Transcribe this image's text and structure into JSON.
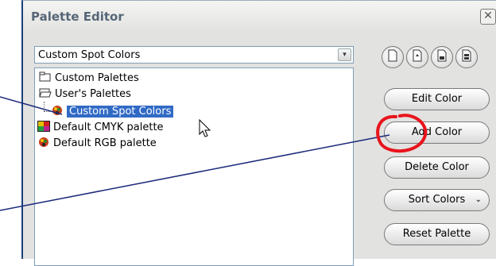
{
  "dialog": {
    "title": "Palette Editor",
    "close_glyph": "✕"
  },
  "combo": {
    "value": "Custom Spot Colors",
    "arrow_glyph": "▾"
  },
  "tree": {
    "items": [
      {
        "label": "Custom Palettes",
        "icon": "folder-closed-icon"
      },
      {
        "label": "User's Palettes",
        "icon": "folder-open-icon"
      },
      {
        "label": "Custom Spot Colors",
        "icon": "palette-icon",
        "selected": true
      },
      {
        "label": "Default CMYK palette",
        "icon": "cmyk-palette-icon"
      },
      {
        "label": "Default RGB palette",
        "icon": "rgb-palette-icon"
      }
    ]
  },
  "toolbar": {
    "icons": [
      "new-palette-icon",
      "open-palette-icon",
      "save-palette-icon",
      "save-as-palette-icon"
    ]
  },
  "buttons": {
    "edit_color": "Edit Color",
    "add_color": "Add Color",
    "delete_color": "Delete Color",
    "sort_colors": "Sort Colors",
    "reset_palette": "Reset Palette"
  },
  "colors": {
    "selection": "#316ac5",
    "annotation_line": "#1a2a7a",
    "annotation_circle": "#e8141c",
    "title_text": "#556677"
  }
}
